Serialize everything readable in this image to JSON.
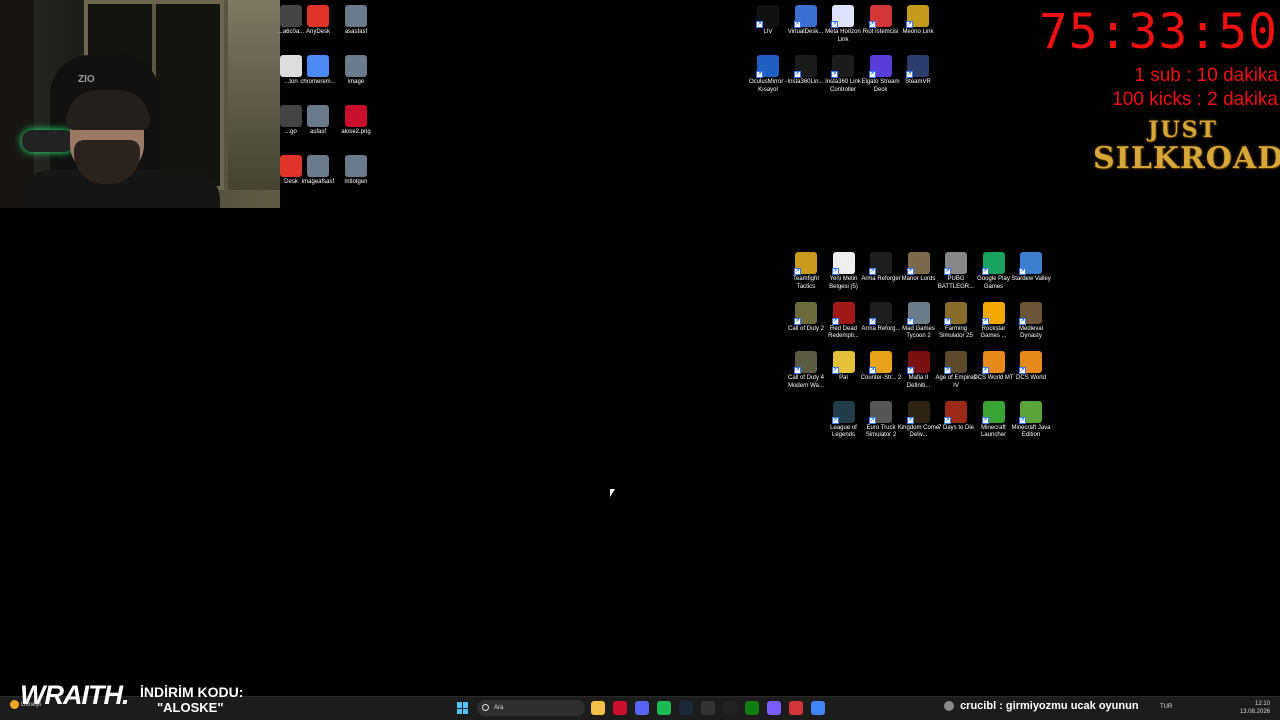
{
  "overlay": {
    "timer": "75:33:50",
    "rate_sub": "1 sub : 10 dakika",
    "rate_kicks": "100 kicks : 2 dakika",
    "logo_line1": "JUST",
    "logo_line2": "SILKROAD",
    "timer_color": "#e11111"
  },
  "desktop_icons_left": [
    {
      "label": "...a6c0a...",
      "icon": "app-icon",
      "color": "#444"
    },
    {
      "label": "AnyDesk",
      "icon": "anydesk-icon",
      "color": "#e0332b"
    },
    {
      "label": "asasfasf",
      "icon": "image-file-icon",
      "color": "#6b7b8c"
    },
    {
      "label": "...ton",
      "icon": "file-icon",
      "color": "#ddd"
    },
    {
      "label": "chromerem...",
      "icon": "chrome-remote-icon",
      "color": "#4c8bf5"
    },
    {
      "label": "image",
      "icon": "image-file-icon",
      "color": "#6b7b8c"
    },
    {
      "label": "...go",
      "icon": "app-icon",
      "color": "#444"
    },
    {
      "label": "asfasf",
      "icon": "image-file-icon",
      "color": "#6b7b8c"
    },
    {
      "label": "alose2.png",
      "icon": "opera-icon",
      "color": "#c8102e"
    },
    {
      "label": "Desk",
      "icon": "anydesk-icon",
      "color": "#e0332b"
    },
    {
      "label": "imageafsasf",
      "icon": "image-file-icon",
      "color": "#6b7b8c"
    },
    {
      "label": "mtlotgen",
      "icon": "image-file-icon",
      "color": "#6b7b8c"
    }
  ],
  "desktop_icons_top_right": [
    {
      "label": "LIV",
      "icon": "liv-icon",
      "color": "#111"
    },
    {
      "label": "VirtualDesk...",
      "icon": "virtual-desktop-icon",
      "color": "#3c6fd1"
    },
    {
      "label": "Meta Horizon Link",
      "icon": "meta-icon",
      "color": "#dfe3ff"
    },
    {
      "label": "Riot İstemcisi",
      "icon": "riot-icon",
      "color": "#d13639"
    },
    {
      "label": "Meono Link",
      "icon": "meono-icon",
      "color": "#c49a1d"
    },
    {
      "label": "OculusMirror - Kısayol",
      "icon": "oculus-icon",
      "color": "#1e5fbf"
    },
    {
      "label": "Insta360Lin...",
      "icon": "insta360-icon",
      "color": "#1b1b1b"
    },
    {
      "label": "Insta360 Link Controller",
      "icon": "insta360-icon",
      "color": "#1b1b1b"
    },
    {
      "label": "Elgato Stream Deck",
      "icon": "stream-deck-icon",
      "color": "#5a3dd8"
    },
    {
      "label": "SteamVR",
      "icon": "steamvr-icon",
      "color": "#2a3d6c"
    }
  ],
  "desktop_icons_games": [
    {
      "label": "Teamfight Tactics",
      "icon": "tft-icon",
      "color": "#c99a1e"
    },
    {
      "label": "Yeni Metin Belgesi (5)",
      "icon": "text-file-icon",
      "color": "#eee"
    },
    {
      "label": "Arma Reforger",
      "icon": "arma-icon",
      "color": "#1e1e1e"
    },
    {
      "label": "Manor Lords",
      "icon": "manor-lords-icon",
      "color": "#7b6a4b"
    },
    {
      "label": "PUBG BATTLEGR...",
      "icon": "pubg-icon",
      "color": "#888"
    },
    {
      "label": "Google Play Games",
      "icon": "google-play-icon",
      "color": "#1aa260"
    },
    {
      "label": "Stardew Valley",
      "icon": "stardew-icon",
      "color": "#3c7fd1"
    },
    {
      "label": "Call of Duty 2",
      "icon": "cod2-icon",
      "color": "#6a6a3a"
    },
    {
      "label": "Red Dead Redempti...",
      "icon": "rdr-icon",
      "color": "#a01818"
    },
    {
      "label": "Arma Reforg...",
      "icon": "arma-icon",
      "color": "#1e1e1e"
    },
    {
      "label": "Mad Games Tycoon 2",
      "icon": "mad-games-icon",
      "color": "#6d7c89"
    },
    {
      "label": "Farming Simulator 25",
      "icon": "farming-sim-icon",
      "color": "#8a6c2c"
    },
    {
      "label": "Rockstar Games ...",
      "icon": "rockstar-icon",
      "color": "#f5a800"
    },
    {
      "label": "Medieval Dynasty",
      "icon": "medieval-dynasty-icon",
      "color": "#6b5438"
    },
    {
      "label": "Call of Duty 4 Modern Wa...",
      "icon": "cod4-icon",
      "color": "#5a5a45"
    },
    {
      "label": "Pal",
      "icon": "pal-icon",
      "color": "#e5c13a"
    },
    {
      "label": "Counter-Str... 2",
      "icon": "cs2-icon",
      "color": "#e8a31b"
    },
    {
      "label": "Mafia II Definiti...",
      "icon": "mafia-icon",
      "color": "#7a1010"
    },
    {
      "label": "Age of Empires IV",
      "icon": "aoe-icon",
      "color": "#5d4a2c"
    },
    {
      "label": "DCS World MT",
      "icon": "dcs-icon",
      "color": "#e8891b"
    },
    {
      "label": "DCS World",
      "icon": "dcs-icon",
      "color": "#e8891b"
    },
    {
      "label": "League of Legends",
      "icon": "lol-icon",
      "color": "#1f3c47"
    },
    {
      "label": "Euro Truck Simulator 2",
      "icon": "ets2-icon",
      "color": "#555"
    },
    {
      "label": "Kingdom Come Deliv...",
      "icon": "kingdom-come-icon",
      "color": "#2d2416"
    },
    {
      "label": "7 Days to Die",
      "icon": "7dtd-icon",
      "color": "#9a2a1a"
    },
    {
      "label": "Minecraft Launcher",
      "icon": "minecraft-icon",
      "color": "#3aa534"
    },
    {
      "label": "Minecraft Java Edition",
      "icon": "minecraft-icon",
      "color": "#5aa43a"
    }
  ],
  "promo": {
    "brand": "WRAITH.",
    "title": "İNDİRİM KODU:",
    "code": "\"ALOSKE\""
  },
  "taskbar": {
    "weather": "Güneşli",
    "search_placeholder": "Ara",
    "chat_user": "crucibl",
    "chat_message": ": girmiyozmu ucak oyunun",
    "lang": "TUR",
    "time": "12:10",
    "date": "13.08.2026",
    "apps": [
      {
        "name": "file-explorer-icon",
        "color": "#f3c14b"
      },
      {
        "name": "opera-icon",
        "color": "#c8102e"
      },
      {
        "name": "discord-icon",
        "color": "#5865f2"
      },
      {
        "name": "spotify-icon",
        "color": "#1db954"
      },
      {
        "name": "steam-icon",
        "color": "#1b2838"
      },
      {
        "name": "epic-icon",
        "color": "#333"
      },
      {
        "name": "capcut-icon",
        "color": "#222"
      },
      {
        "name": "xbox-icon",
        "color": "#107c10"
      },
      {
        "name": "copilot-icon",
        "color": "#7b5cff"
      },
      {
        "name": "riot-icon",
        "color": "#d13639"
      },
      {
        "name": "chrome-icon",
        "color": "#4285f4"
      }
    ]
  }
}
